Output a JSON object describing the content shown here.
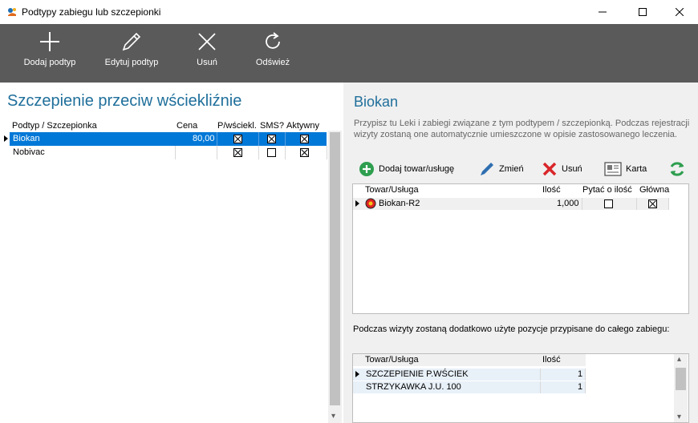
{
  "window": {
    "title": "Podtypy zabiegu lub szczepionki",
    "minimize": "—",
    "maximize": "☐",
    "close": "✕"
  },
  "toolbar": {
    "add_label": "Dodaj podtyp",
    "edit_label": "Edytuj podtyp",
    "delete_label": "Usuń",
    "refresh_label": "Odśwież"
  },
  "left": {
    "title": "Szczepienie przeciw wściekliźnie",
    "columns": [
      "Podtyp / Szczepionka",
      "Cena",
      "P/wściekl.",
      "SMS?",
      "Aktywny"
    ],
    "rows": [
      {
        "name": "Biokan",
        "price": "80,00",
        "p_wsciekl": true,
        "sms": true,
        "active": true,
        "selected": true
      },
      {
        "name": "Nobivac",
        "price": "",
        "p_wsciekl": true,
        "sms": false,
        "active": true,
        "selected": false
      }
    ]
  },
  "right": {
    "title": "Biokan",
    "description": "Przypisz tu Leki i zabiegi związane z tym podtypem / szczepionką. Podczas rejestracji wizyty zostaną one automatycznie umieszczone w opisie zastosowanego leczenia.",
    "buttons": {
      "add": "Dodaj towar/usługę",
      "edit": "Zmień",
      "delete": "Usuń",
      "card": "Karta"
    },
    "grid_columns": [
      "Towar/Usługa",
      "Ilość",
      "Pytać o ilość",
      "Główna"
    ],
    "grid_rows": [
      {
        "name": "Biokan-R2",
        "qty": "1,000",
        "ask_qty": false,
        "main": true
      }
    ],
    "note": "Podczas wizyty zostaną dodatkowo użyte pozycje przypisane do całego zabiegu:",
    "bottom_columns": [
      "Towar/Usługa",
      "Ilość"
    ],
    "bottom_rows": [
      {
        "name": "SZCZEPIENIE P.WŚCIEK",
        "qty": "1"
      },
      {
        "name": "STRZYKAWKA J.U. 100",
        "qty": "1"
      }
    ]
  },
  "colors": {
    "toolbar_bg": "#5a5a5a",
    "accent_title": "#1f6f9b",
    "selection": "#0078d7",
    "add_green": "#2e9e4f",
    "delete_red": "#d9262a"
  }
}
